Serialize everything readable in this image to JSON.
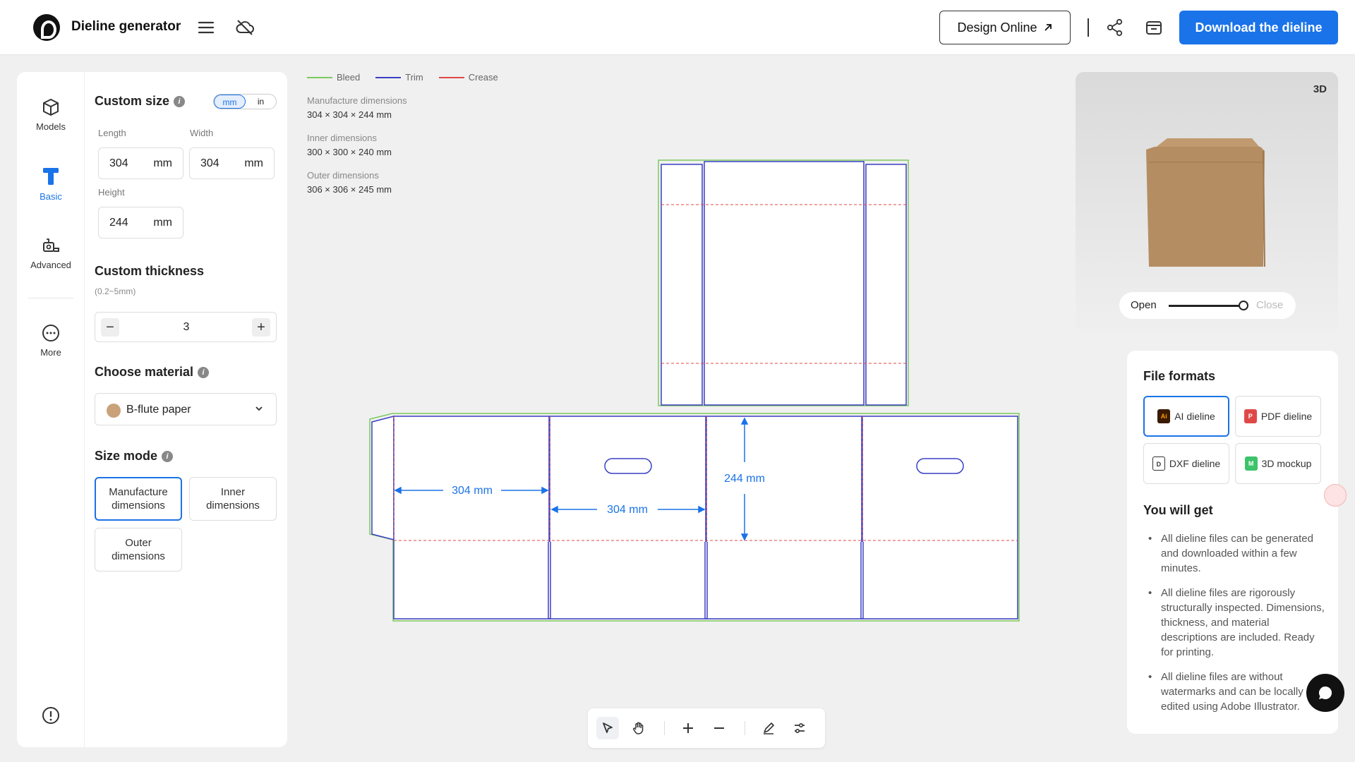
{
  "header": {
    "app_title": "Dieline generator",
    "design_online_label": "Design Online",
    "download_label": "Download the dieline"
  },
  "rail": {
    "models": "Models",
    "basic": "Basic",
    "advanced": "Advanced",
    "more": "More"
  },
  "panel": {
    "custom_size_title": "Custom size",
    "unit_mm": "mm",
    "unit_in": "in",
    "length_label": "Length",
    "width_label": "Width",
    "height_label": "Height",
    "length_value": "304",
    "width_value": "304",
    "height_value": "244",
    "unit": "mm",
    "thickness_title": "Custom thickness",
    "thickness_range": "(0.2~5mm)",
    "thickness_value": "3",
    "minus": "−",
    "plus": "+",
    "material_title": "Choose material",
    "material_value": "B-flute paper",
    "size_mode_title": "Size mode",
    "mode_manufacture": "Manufacture dimensions",
    "mode_inner": "Inner dimensions",
    "mode_outer": "Outer dimensions"
  },
  "legend": {
    "bleed": "Bleed",
    "trim": "Trim",
    "crease": "Crease",
    "bleed_color": "#7dc95e",
    "trim_color": "#3a3ec2",
    "crease_color": "#e04848"
  },
  "dims": {
    "manufacture_label": "Manufacture dimensions",
    "manufacture_value": "304 × 304 × 244 mm",
    "inner_label": "Inner dimensions",
    "inner_value": "300 × 300 × 240 mm",
    "outer_label": "Outer dimensions",
    "outer_value": "306 × 306 × 245 mm"
  },
  "dieline": {
    "length_label": "304 mm",
    "width_label": "304 mm",
    "height_label": "244 mm"
  },
  "preview": {
    "badge": "3D",
    "open_label": "Open",
    "close_label": "Close",
    "fold_level": 1.0
  },
  "formats": {
    "title": "File formats",
    "ai": "AI dieline",
    "pdf": "PDF dieline",
    "dxf": "DXF dieline",
    "mockup": "3D mockup",
    "you_will_get": "You will get",
    "benefits": [
      "All dieline files can be generated and downloaded within a few minutes.",
      "All dieline files are rigorously structurally inspected. Dimensions, thickness, and material descriptions are included. Ready for printing.",
      "All dieline files are without watermarks and can be locally edited using Adobe Illustrator."
    ]
  },
  "colors": {
    "accent": "#1a73e8",
    "dimension_blue": "#1a73e8"
  }
}
